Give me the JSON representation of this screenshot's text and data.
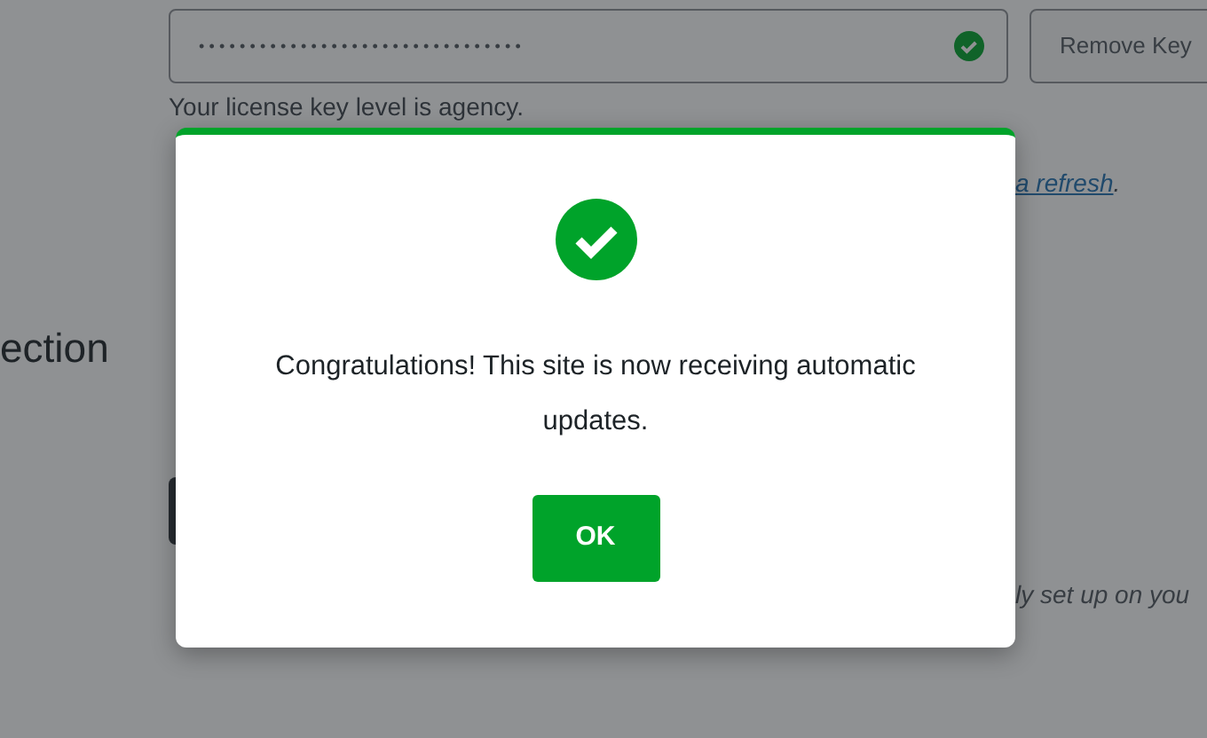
{
  "license_key": {
    "value": "••••••••••••••••••••••••••••••••",
    "valid": true
  },
  "remove_key_button": "Remove Key",
  "license_level_text": "Your license key level is agency.",
  "refresh_link": "a refresh",
  "refresh_suffix": ".",
  "section_heading": "ection",
  "note_text": "ly set up on you",
  "dialog": {
    "kind": "success",
    "message": "Congratulations! This site is now receiving automatic updates.",
    "button": "OK"
  }
}
